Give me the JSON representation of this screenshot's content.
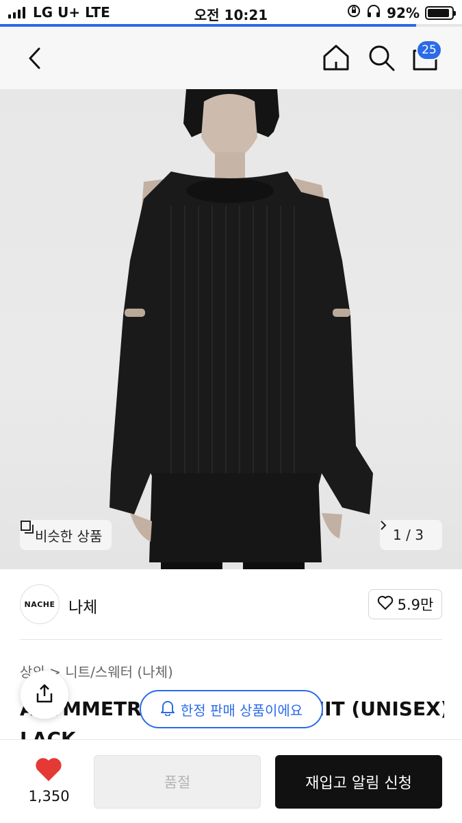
{
  "status_bar": {
    "carrier": "LG U+  LTE",
    "time": "오전 10:21",
    "battery": "92%",
    "battery_level": 0.92
  },
  "page_load_progress": 0.9,
  "header": {
    "back_icon": "chevron-left-icon",
    "home_icon": "home-icon",
    "search_icon": "search-icon",
    "cart_icon": "cart-icon",
    "cart_count": "25",
    "accent_color": "#2b6be8"
  },
  "gallery": {
    "similar_label": "비슷한 상품",
    "pager": "1 / 3"
  },
  "brand": {
    "logo_text": "NACHE",
    "name": "나체",
    "likes": "5.9만"
  },
  "product": {
    "breadcrumb": "상의 > 니트/스웨터 (나체)",
    "title_line1": "ASYMMETRIC SHOULDER KNIT (UNISEX) B",
    "title_line2": "LACK",
    "limited_badge": "한정 판매 상품이에요"
  },
  "bottom_bar": {
    "wish_count": "1,350",
    "soldout_label": "품절",
    "restock_label": "재입고 알림 신청"
  }
}
